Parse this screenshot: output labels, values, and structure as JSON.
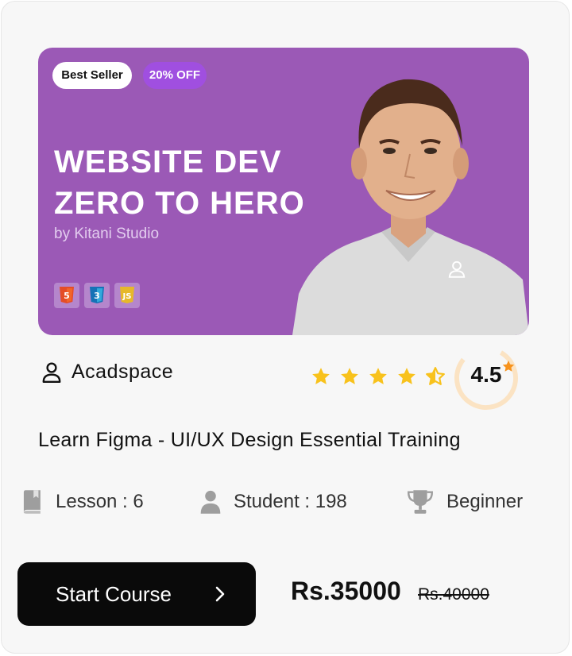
{
  "badges": {
    "best_seller": "Best Seller",
    "discount": "20% OFF"
  },
  "banner": {
    "title_line1": "WEBSITE DEV",
    "title_line2": "ZERO TO HERO",
    "byline": "by Kitani Studio",
    "tech_icons": [
      "html5-icon",
      "css3-icon",
      "javascript-icon"
    ],
    "background_color": "#9b59b6"
  },
  "instructor": {
    "name": "Acadspace",
    "icon": "user-icon"
  },
  "rating": {
    "value": "4.5",
    "stars": 4.5,
    "max_stars": 5,
    "star_color": "#f8c21c"
  },
  "course": {
    "title": "Learn Figma - UI/UX Design Essential Training"
  },
  "meta": {
    "lesson": "Lesson : 6",
    "student": "Student : 198",
    "level": "Beginner"
  },
  "cta": {
    "label": "Start Course"
  },
  "pricing": {
    "price": "Rs.35000",
    "original_price": "Rs.40000"
  }
}
